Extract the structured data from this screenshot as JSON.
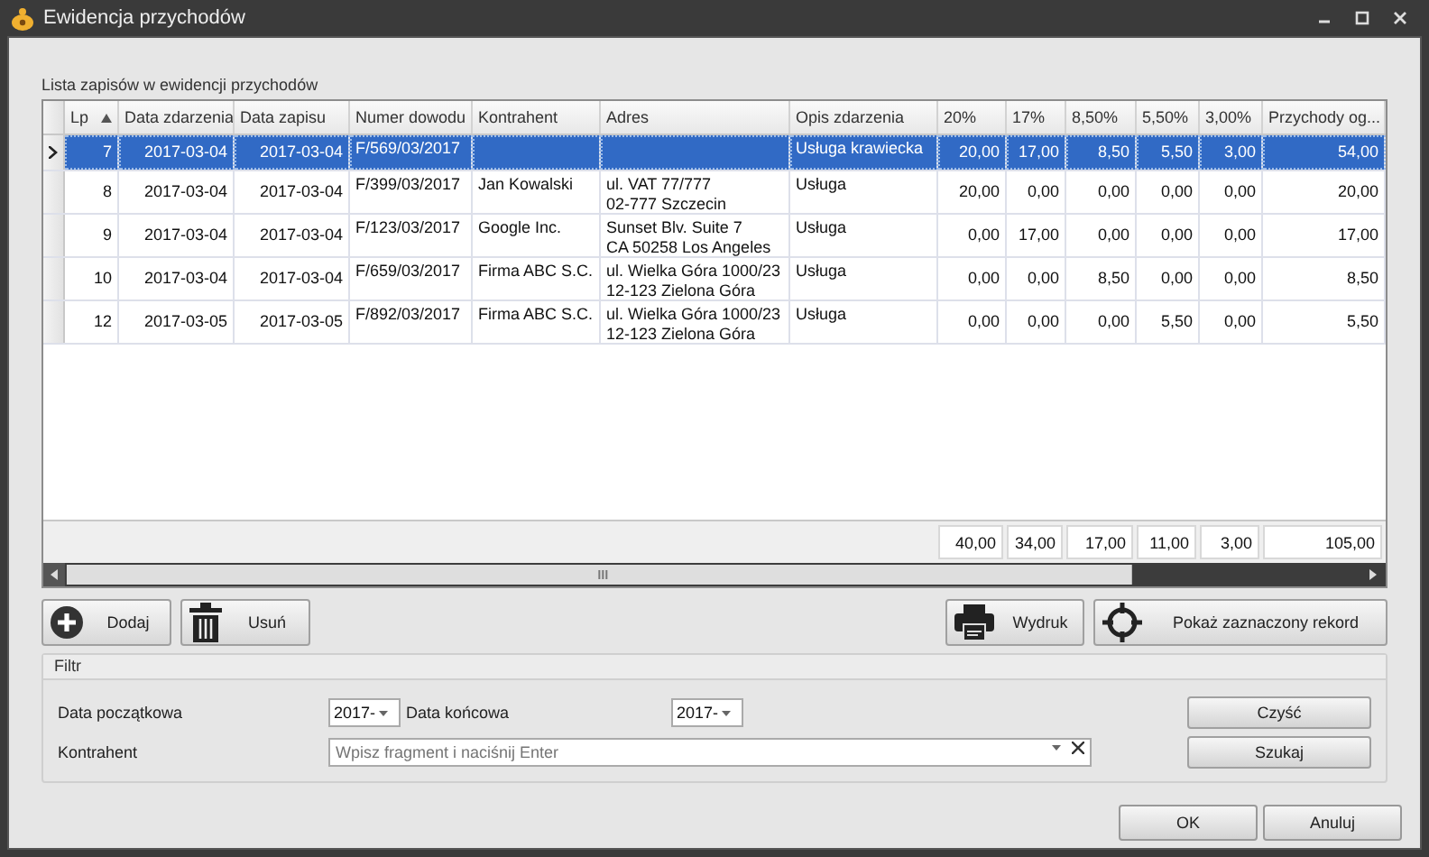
{
  "window": {
    "title": "Ewidencja przychodów"
  },
  "grid": {
    "label": "Lista zapisów w ewidencji przychodów",
    "columns": [
      {
        "label": "Lp",
        "kind": "number",
        "sorted": true
      },
      {
        "label": "Data zdarzenia",
        "kind": "number",
        "sorted": false
      },
      {
        "label": "Data zapisu",
        "kind": "number",
        "sorted": false
      },
      {
        "label": "Numer dowodu",
        "kind": "text",
        "sorted": false
      },
      {
        "label": "Kontrahent",
        "kind": "text",
        "sorted": false
      },
      {
        "label": "Adres",
        "kind": "text",
        "sorted": false
      },
      {
        "label": "Opis zdarzenia",
        "kind": "text",
        "sorted": false
      },
      {
        "label": "20%",
        "kind": "number",
        "sorted": false
      },
      {
        "label": "17%",
        "kind": "number",
        "sorted": false
      },
      {
        "label": "8,50%",
        "kind": "number",
        "sorted": false
      },
      {
        "label": "5,50%",
        "kind": "number",
        "sorted": false
      },
      {
        "label": "3,00%",
        "kind": "number",
        "sorted": false
      },
      {
        "label": "Przychody og...",
        "kind": "number",
        "sorted": false
      }
    ],
    "rows": [
      {
        "selected": true,
        "cells": [
          "7",
          "2017-03-04",
          "2017-03-04",
          "F/569/03/2017",
          "",
          "",
          "Usługa krawiecka",
          "20,00",
          "17,00",
          "8,50",
          "5,50",
          "3,00",
          "54,00"
        ]
      },
      {
        "selected": false,
        "cells": [
          "8",
          "2017-03-04",
          "2017-03-04",
          "F/399/03/2017",
          "Jan Kowalski",
          "ul. VAT 77/777\n02-777 Szczecin",
          "Usługa",
          "20,00",
          "0,00",
          "0,00",
          "0,00",
          "0,00",
          "20,00"
        ]
      },
      {
        "selected": false,
        "cells": [
          "9",
          "2017-03-04",
          "2017-03-04",
          "F/123/03/2017",
          "Google Inc.",
          "Sunset Blv. Suite 7\nCA 50258 Los Angeles",
          "Usługa",
          "0,00",
          "17,00",
          "0,00",
          "0,00",
          "0,00",
          "17,00"
        ]
      },
      {
        "selected": false,
        "cells": [
          "10",
          "2017-03-04",
          "2017-03-04",
          "F/659/03/2017",
          "Firma ABC S.C.",
          "ul. Wielka Góra 1000/23\n12-123 Zielona Góra",
          "Usługa",
          "0,00",
          "0,00",
          "8,50",
          "0,00",
          "0,00",
          "8,50"
        ]
      },
      {
        "selected": false,
        "cells": [
          "12",
          "2017-03-05",
          "2017-03-05",
          "F/892/03/2017",
          "Firma ABC S.C.",
          "ul. Wielka Góra 1000/23\n12-123 Zielona Góra",
          "Usługa",
          "0,00",
          "0,00",
          "0,00",
          "5,50",
          "0,00",
          "5,50"
        ]
      }
    ],
    "totals": [
      "40,00",
      "34,00",
      "17,00",
      "11,00",
      "3,00",
      "105,00"
    ]
  },
  "actions": [
    {
      "label": "Dodaj",
      "kind": "add"
    },
    {
      "label": "Usuń",
      "kind": "delete"
    },
    {
      "label": "Wydruk",
      "kind": "print"
    },
    {
      "label": "Pokaż zaznaczony rekord",
      "kind": "target"
    }
  ],
  "filter": {
    "title": "Filtr",
    "date_from_label": "Data początkowa",
    "date_from": "2017-",
    "date_to_label": "Data końcowa",
    "date_to": "2017-",
    "contractor_label": "Kontrahent",
    "contractor_placeholder": "Wpisz fragment i naciśnij Enter",
    "clear_button": "Czyść",
    "search_button": "Szukaj"
  },
  "buttons": [
    "OK",
    "Anuluj"
  ]
}
